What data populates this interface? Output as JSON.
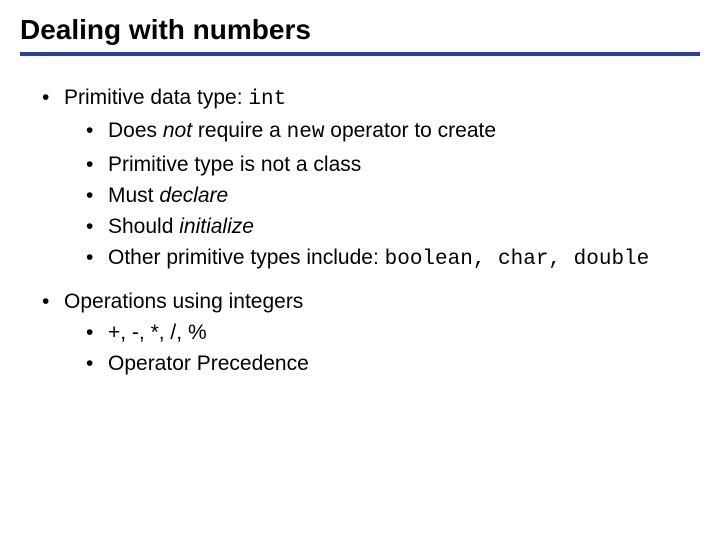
{
  "title": "Dealing with numbers",
  "b1": {
    "head_pre": "Primitive data type: ",
    "head_code": "int",
    "s1_a": "Does ",
    "s1_i": "not",
    "s1_b": " require a ",
    "s1_code": "new",
    "s1_c": " operator to create",
    "s2": "Primitive type is not a class",
    "s3_a": "Must ",
    "s3_i": "declare",
    "s4_a": "Should ",
    "s4_i": "initialize",
    "s5_a": "Other primitive types include: ",
    "s5_code": "boolean, char, double"
  },
  "b2": {
    "head": "Operations using integers",
    "s1": "+,   -,   *,   /,   %",
    "s2": "Operator Precedence"
  }
}
